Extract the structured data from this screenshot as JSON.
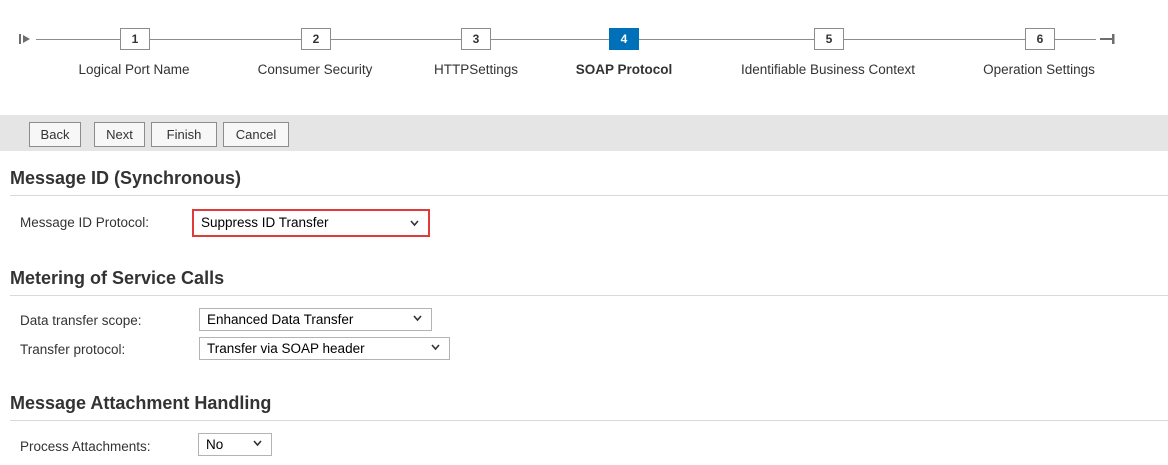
{
  "wizard": {
    "steps": [
      {
        "number": "1",
        "label": "Logical Port Name"
      },
      {
        "number": "2",
        "label": "Consumer Security"
      },
      {
        "number": "3",
        "label": "HTTPSettings"
      },
      {
        "number": "4",
        "label": "SOAP Protocol",
        "active": true
      },
      {
        "number": "5",
        "label": "Identifiable Business Context"
      },
      {
        "number": "6",
        "label": "Operation Settings"
      }
    ]
  },
  "toolbar": {
    "back_label": "Back",
    "next_label": "Next",
    "finish_label": "Finish",
    "cancel_label": "Cancel"
  },
  "message_id": {
    "title": "Message ID (Synchronous)",
    "protocol_label": "Message ID Protocol:",
    "protocol_value": "Suppress ID Transfer"
  },
  "metering": {
    "title": "Metering of Service Calls",
    "scope_label": "Data transfer scope:",
    "scope_value": "Enhanced Data Transfer",
    "protocol_label": "Transfer protocol:",
    "protocol_value": "Transfer via SOAP header"
  },
  "attachments": {
    "title": "Message Attachment Handling",
    "process_label": "Process Attachments:",
    "process_value": "No"
  },
  "colors": {
    "active_step": "#0070b8",
    "focus_border": "#e03b3b",
    "toolbar_bg": "#e5e5e5"
  }
}
